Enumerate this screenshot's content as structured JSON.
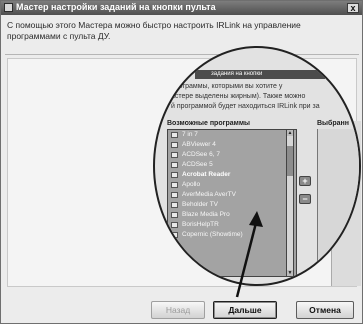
{
  "window": {
    "title": "Мастер настройки заданий на кнопки пульта",
    "close_glyph": "x"
  },
  "intro_text": "С помощью этого Мастера можно быстро настроить IRLink на управление программами с пульта ДУ.",
  "magnified": {
    "header_text": "задания на кнопки",
    "description_lines": [
      "программы, которыми вы хотите у",
      "астере выделены жирным). Также можно",
      "й программой будет находиться IRLink при за"
    ],
    "available_label": "Возможные программы",
    "selected_label": "Выбранн",
    "scroll_up_glyph": "▲",
    "scroll_down_glyph": "▼",
    "add_glyph": "+",
    "remove_glyph": "−",
    "footer_text": "...",
    "programs": [
      {
        "label": "7 in 7",
        "bold": false
      },
      {
        "label": "ABViewer 4",
        "bold": false
      },
      {
        "label": "ACDSee 6, 7",
        "bold": false
      },
      {
        "label": "ACDSee 5",
        "bold": false
      },
      {
        "label": "Acrobat Reader",
        "bold": true
      },
      {
        "label": "Apollo",
        "bold": false
      },
      {
        "label": "AverMedia AverTV",
        "bold": false
      },
      {
        "label": "Beholder TV",
        "bold": false
      },
      {
        "label": "Blaze Media Pro",
        "bold": false
      },
      {
        "label": "BorisHelpTR",
        "bold": false
      },
      {
        "label": "Copernic (Showtime)",
        "bold": false
      }
    ]
  },
  "buttons": {
    "back": "Назад",
    "next": "Дальше",
    "cancel": "Отмена"
  },
  "colors": {
    "titlebar": "#5a5a5a",
    "list_bg": "#a3a3a3",
    "window_bg": "#ececec"
  }
}
